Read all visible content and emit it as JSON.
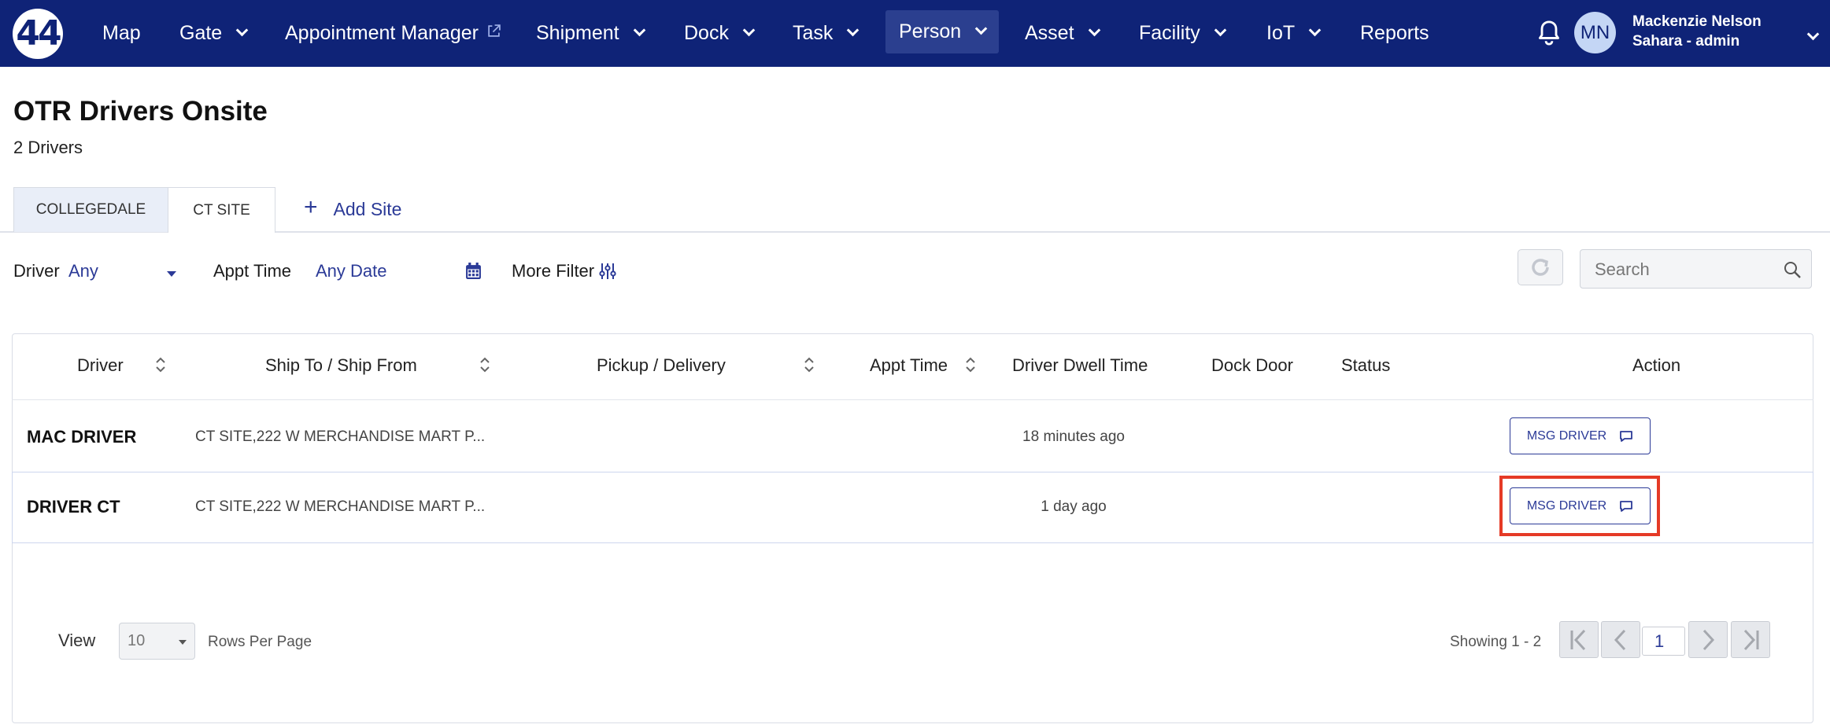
{
  "app": {
    "logo_text": "44",
    "accent_color": "#0f2377",
    "link_color": "#2b3a97",
    "highlight_color": "#e53a26"
  },
  "nav": {
    "items": [
      {
        "label": "Map"
      },
      {
        "label": "Gate"
      },
      {
        "label": "Appointment Manager"
      },
      {
        "label": "Shipment"
      },
      {
        "label": "Dock"
      },
      {
        "label": "Task"
      },
      {
        "label": "Person"
      },
      {
        "label": "Asset"
      },
      {
        "label": "Facility"
      },
      {
        "label": "IoT"
      },
      {
        "label": "Reports"
      }
    ],
    "active": "Person"
  },
  "user": {
    "initials": "MN",
    "name": "Mackenzie Nelson",
    "role": "Sahara - admin"
  },
  "page": {
    "title": "OTR Drivers Onsite",
    "subtitle": "2 Drivers"
  },
  "tabs": {
    "items": [
      {
        "label": "COLLEGEDALE"
      },
      {
        "label": "CT SITE"
      }
    ],
    "active": "CT SITE",
    "add_label": "Add Site"
  },
  "filters": {
    "driver_label": "Driver",
    "driver_value": "Any",
    "appt_label": "Appt Time",
    "appt_value": "Any Date",
    "more_label": "More Filter",
    "search_placeholder": "Search"
  },
  "table": {
    "columns": [
      "Driver",
      "Ship To / Ship From",
      "Pickup / Delivery",
      "Appt Time",
      "Driver Dwell Time",
      "Dock Door",
      "Status",
      "Action"
    ],
    "rows": [
      {
        "driver": "MAC DRIVER",
        "ship": "CT SITE,222 W MERCHANDISE MART P...",
        "pickup": "",
        "appt": "",
        "dwell": "18 minutes ago",
        "dock": "",
        "status": "",
        "action": "MSG DRIVER"
      },
      {
        "driver": "DRIVER CT",
        "ship": "CT SITE,222 W MERCHANDISE MART P...",
        "pickup": "",
        "appt": "",
        "dwell": "1 day ago",
        "dock": "",
        "status": "",
        "action": "MSG DRIVER"
      }
    ]
  },
  "pagination": {
    "view_label": "View",
    "rows_per_page": "10",
    "rows_label": "Rows Per Page",
    "showing": "Showing 1 - 2",
    "page": "1"
  }
}
